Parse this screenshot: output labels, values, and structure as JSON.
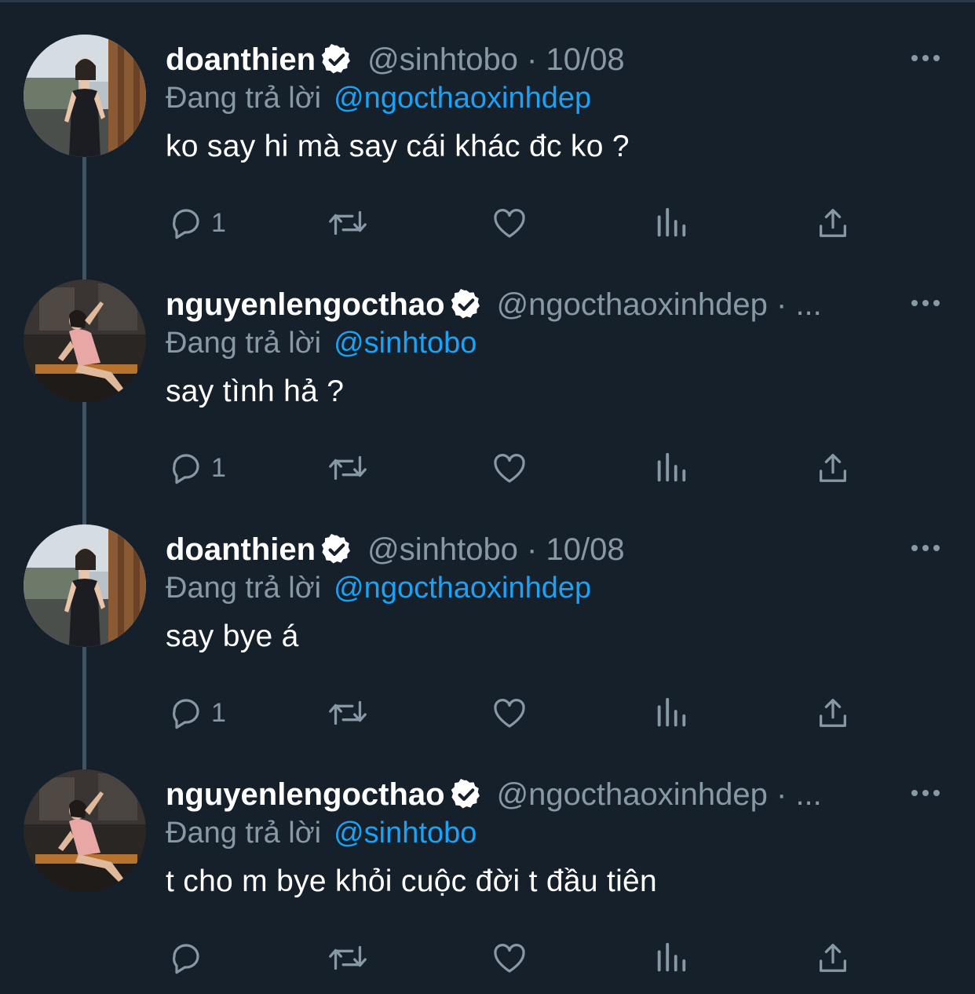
{
  "colors": {
    "background": "#15202b",
    "muted": "#8899a6",
    "link": "#1da1f2",
    "thread_line": "#3d5466"
  },
  "tweets": [
    {
      "display_name": "doanthien",
      "verified": true,
      "meta": "@sinhtobo · 10/08",
      "reply_prefix": "Đang trả lời",
      "reply_to": "@ngocthaoxinhdep",
      "text": "ko say hi mà say cái khác đc ko ?",
      "reply_count": "1",
      "avatar": "avatar-woman-black-dress",
      "icons": [
        "reply-icon",
        "retweet-icon",
        "like-icon",
        "analytics-icon",
        "share-icon",
        "more-icon"
      ]
    },
    {
      "display_name": "nguyenlengocthao",
      "verified": true,
      "meta": "@ngocthaoxinhdep · ...",
      "reply_prefix": "Đang trả lời",
      "reply_to": "@sinhtobo",
      "text": "say tình hả ?",
      "reply_count": "1",
      "avatar": "avatar-woman-pink-dress",
      "icons": [
        "reply-icon",
        "retweet-icon",
        "like-icon",
        "analytics-icon",
        "share-icon",
        "more-icon"
      ]
    },
    {
      "display_name": "doanthien",
      "verified": true,
      "meta": "@sinhtobo · 10/08",
      "reply_prefix": "Đang trả lời",
      "reply_to": "@ngocthaoxinhdep",
      "text": "say bye á",
      "reply_count": "1",
      "avatar": "avatar-woman-black-dress",
      "icons": [
        "reply-icon",
        "retweet-icon",
        "like-icon",
        "analytics-icon",
        "share-icon",
        "more-icon"
      ]
    },
    {
      "display_name": "nguyenlengocthao",
      "verified": true,
      "meta": "@ngocthaoxinhdep · ...",
      "reply_prefix": "Đang trả lời",
      "reply_to": "@sinhtobo",
      "text": "t cho m bye khỏi cuộc đời t đầu tiên",
      "reply_count": "",
      "avatar": "avatar-woman-pink-dress",
      "icons": [
        "reply-icon",
        "retweet-icon",
        "like-icon",
        "analytics-icon",
        "share-icon",
        "more-icon"
      ]
    }
  ]
}
